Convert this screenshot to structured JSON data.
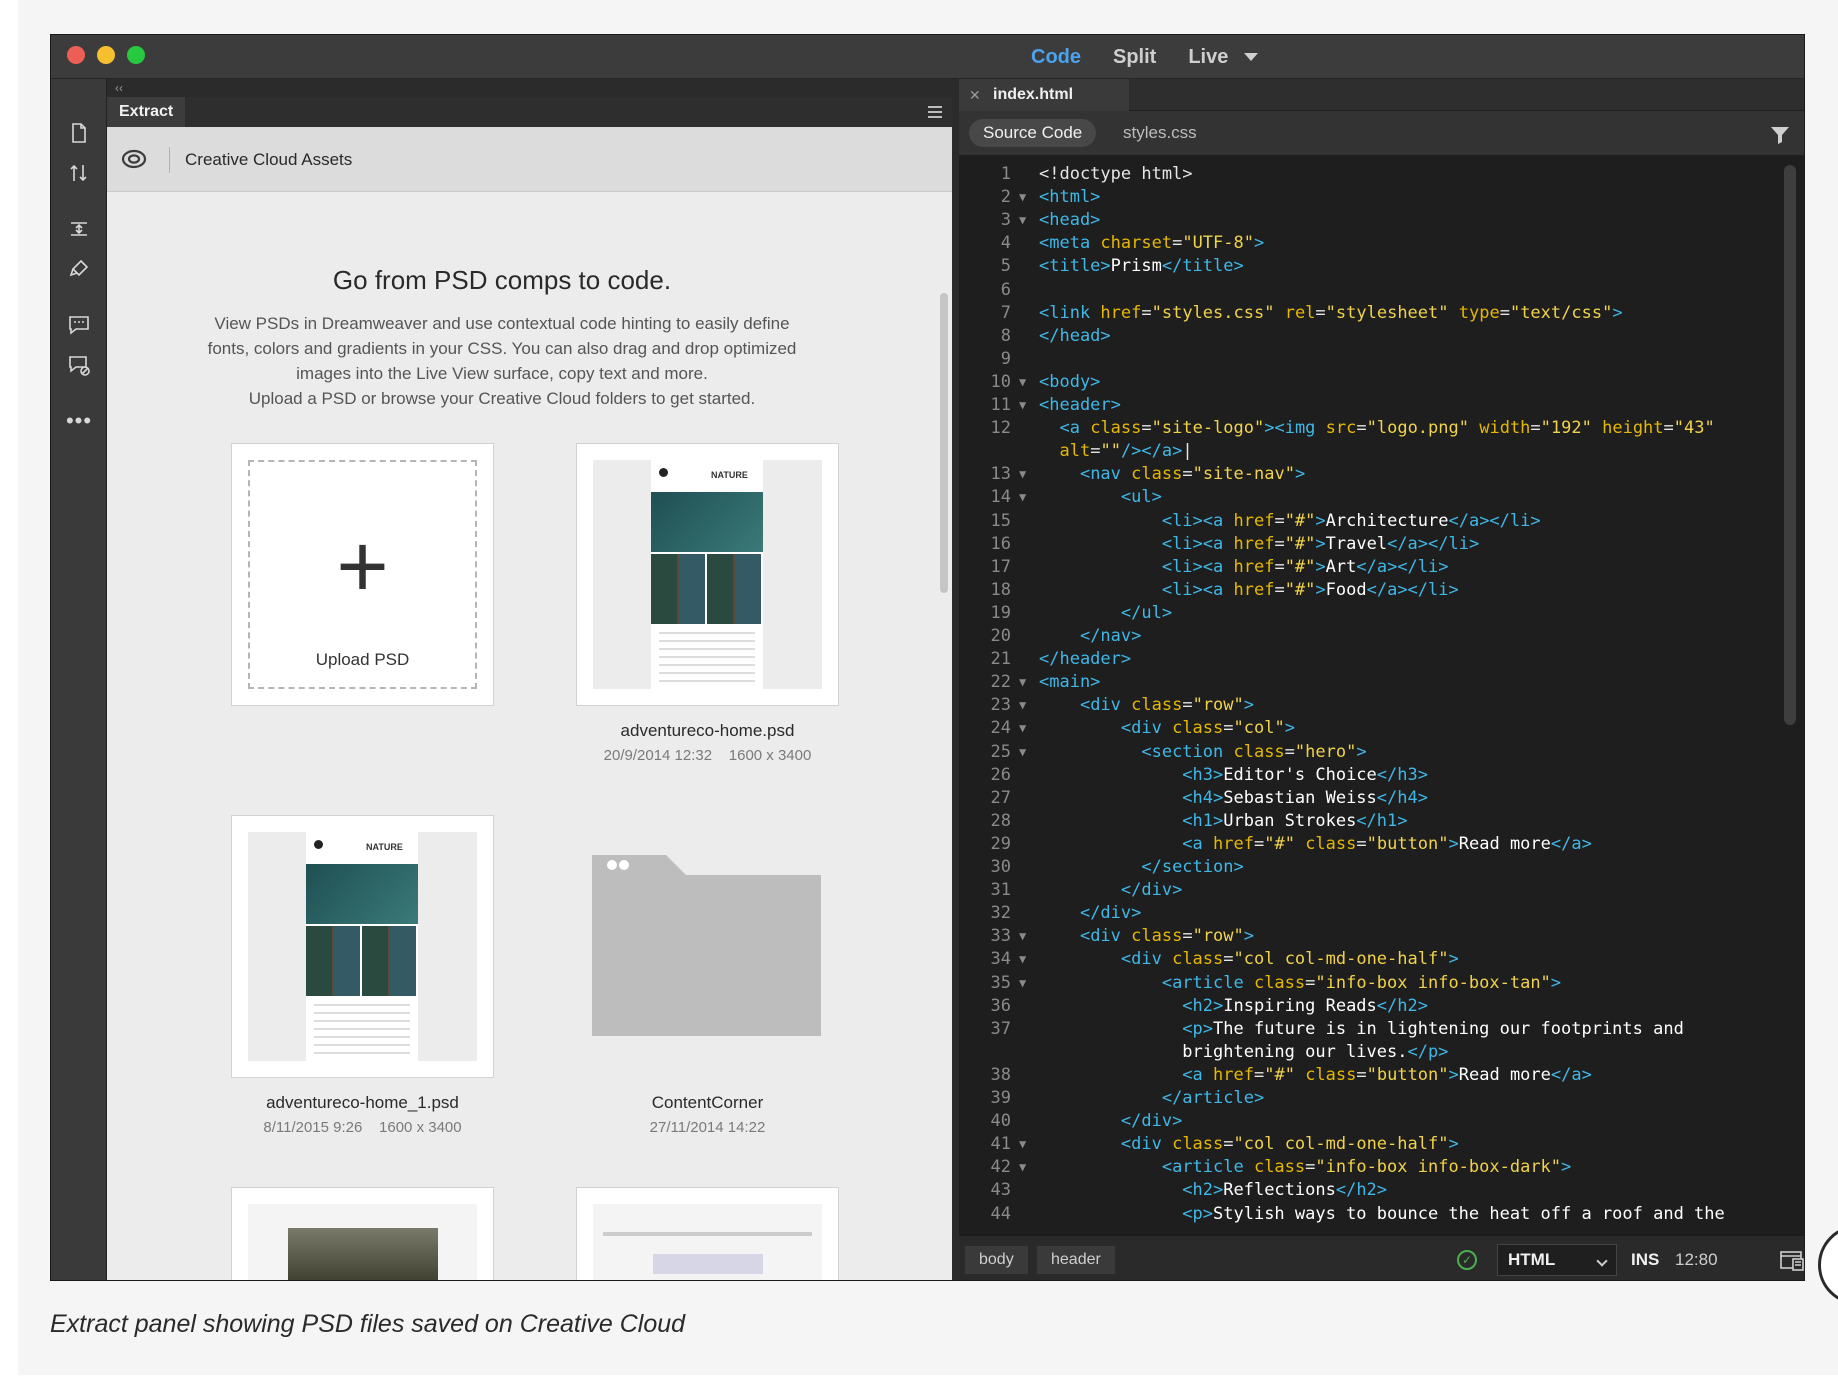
{
  "window": {
    "view_modes": [
      "Code",
      "Split",
      "Live"
    ],
    "active_view": "Code",
    "traffic_colors": [
      "#ed5e56",
      "#f5bf2e",
      "#29c841"
    ]
  },
  "toolbar": {
    "icons": [
      "new-file-icon",
      "get-put-files-icon",
      "expand-collapse-icon",
      "format-source-icon",
      "comment-icon",
      "remove-comment-icon",
      "more-icon"
    ]
  },
  "extract": {
    "panel_tab": "Extract",
    "header_title": "Creative Cloud Assets",
    "hero_title": "Go from PSD comps to code.",
    "hero_lines": [
      "View PSDs in Dreamweaver and use contextual code hinting to easily define",
      "fonts, colors and gradients in your CSS. You can also drag and drop optimized",
      "images into the Live View surface, copy text and more.",
      "Upload a PSD or browse your Creative Cloud folders to get started."
    ],
    "upload_label": "Upload PSD",
    "files": [
      {
        "name": "adventureco-home.psd",
        "date": "20/9/2014 12:32",
        "size": "1600 x 3400"
      },
      {
        "name": "adventureco-home_1.psd",
        "date": "8/11/2015 9:26",
        "size": "1600 x 3400"
      },
      {
        "name": "ContentCorner",
        "date": "27/11/2014 14:22",
        "size": ""
      }
    ],
    "thumb_title": "NATURE"
  },
  "editor": {
    "file_tab": "index.html",
    "related_files": [
      "Source Code",
      "styles.css"
    ],
    "lines": [
      {
        "n": "1",
        "fold": "",
        "html": "&lt;!doctype html&gt;",
        "indent": 0
      },
      {
        "n": "2",
        "fold": "▼",
        "html": "<span class='t'>&lt;html&gt;</span>",
        "indent": 0
      },
      {
        "n": "3",
        "fold": "▼",
        "html": "<span class='t'>&lt;head&gt;</span>",
        "indent": 0
      },
      {
        "n": "4",
        "fold": "",
        "html": "<span class='t'>&lt;meta </span><span class='a'>charset</span>=<span class='s'>\"UTF-8\"</span><span class='t'>&gt;</span>",
        "indent": 0
      },
      {
        "n": "5",
        "fold": "",
        "html": "<span class='t'>&lt;title&gt;</span><span class='x'>Prism</span><span class='t'>&lt;/title&gt;</span>",
        "indent": 0
      },
      {
        "n": "6",
        "fold": "",
        "html": "",
        "indent": 0
      },
      {
        "n": "7",
        "fold": "",
        "html": "<span class='t'>&lt;link </span><span class='a'>href</span>=<span class='s'>\"styles.css\"</span> <span class='a'>rel</span>=<span class='s'>\"stylesheet\"</span> <span class='a'>type</span>=<span class='s'>\"text/css\"</span><span class='t'>&gt;</span>",
        "indent": 0
      },
      {
        "n": "8",
        "fold": "",
        "html": "<span class='t'>&lt;/head&gt;</span>",
        "indent": 0
      },
      {
        "n": "9",
        "fold": "",
        "html": "",
        "indent": 0
      },
      {
        "n": "10",
        "fold": "▼",
        "html": "<span class='t'>&lt;body&gt;</span>",
        "indent": 0
      },
      {
        "n": "11",
        "fold": "▼",
        "html": "<span class='t'>&lt;header&gt;</span>",
        "indent": 0
      },
      {
        "n": "12",
        "fold": "",
        "html": "  <span class='t'>&lt;a </span><span class='a'>class</span>=<span class='s'>\"site-logo\"</span><span class='t'>&gt;&lt;img </span><span class='a'>src</span>=<span class='s'>\"logo.png\"</span> <span class='a'>width</span>=<span class='s'>\"192\"</span> <span class='a'>height</span>=<span class='s'>\"43\"</span>",
        "indent": 0
      },
      {
        "n": "",
        "fold": "",
        "html": "  <span class='a'>alt</span>=<span class='s'>\"\"</span><span class='t'>/&gt;&lt;/a&gt;</span>|",
        "indent": 0
      },
      {
        "n": "13",
        "fold": "▼",
        "html": "    <span class='t'>&lt;nav </span><span class='a'>class</span>=<span class='s'>\"site-nav\"</span><span class='t'>&gt;</span>",
        "indent": 0
      },
      {
        "n": "14",
        "fold": "▼",
        "html": "        <span class='t'>&lt;ul&gt;</span>",
        "indent": 0
      },
      {
        "n": "15",
        "fold": "",
        "html": "            <span class='t'>&lt;li&gt;&lt;a </span><span class='a'>href</span>=<span class='s'>\"#\"</span><span class='t'>&gt;</span><span class='x'>Architecture</span><span class='t'>&lt;/a&gt;&lt;/li&gt;</span>",
        "indent": 0
      },
      {
        "n": "16",
        "fold": "",
        "html": "            <span class='t'>&lt;li&gt;&lt;a </span><span class='a'>href</span>=<span class='s'>\"#\"</span><span class='t'>&gt;</span><span class='x'>Travel</span><span class='t'>&lt;/a&gt;&lt;/li&gt;</span>",
        "indent": 0
      },
      {
        "n": "17",
        "fold": "",
        "html": "            <span class='t'>&lt;li&gt;&lt;a </span><span class='a'>href</span>=<span class='s'>\"#\"</span><span class='t'>&gt;</span><span class='x'>Art</span><span class='t'>&lt;/a&gt;&lt;/li&gt;</span>",
        "indent": 0
      },
      {
        "n": "18",
        "fold": "",
        "html": "            <span class='t'>&lt;li&gt;&lt;a </span><span class='a'>href</span>=<span class='s'>\"#\"</span><span class='t'>&gt;</span><span class='x'>Food</span><span class='t'>&lt;/a&gt;&lt;/li&gt;</span>",
        "indent": 0
      },
      {
        "n": "19",
        "fold": "",
        "html": "        <span class='t'>&lt;/ul&gt;</span>",
        "indent": 0
      },
      {
        "n": "20",
        "fold": "",
        "html": "    <span class='t'>&lt;/nav&gt;</span>",
        "indent": 0
      },
      {
        "n": "21",
        "fold": "",
        "html": "<span class='t'>&lt;/header&gt;</span>",
        "indent": 0
      },
      {
        "n": "22",
        "fold": "▼",
        "html": "<span class='t'>&lt;main&gt;</span>",
        "indent": 0
      },
      {
        "n": "23",
        "fold": "▼",
        "html": "    <span class='t'>&lt;div </span><span class='a'>class</span>=<span class='s'>\"row\"</span><span class='t'>&gt;</span>",
        "indent": 0
      },
      {
        "n": "24",
        "fold": "▼",
        "html": "        <span class='t'>&lt;div </span><span class='a'>class</span>=<span class='s'>\"col\"</span><span class='t'>&gt;</span>",
        "indent": 0
      },
      {
        "n": "25",
        "fold": "▼",
        "html": "          <span class='t'>&lt;section </span><span class='a'>class</span>=<span class='s'>\"hero\"</span><span class='t'>&gt;</span>",
        "indent": 0
      },
      {
        "n": "26",
        "fold": "",
        "html": "              <span class='t'>&lt;h3&gt;</span><span class='x'>Editor's Choice</span><span class='t'>&lt;/h3&gt;</span>",
        "indent": 0
      },
      {
        "n": "27",
        "fold": "",
        "html": "              <span class='t'>&lt;h4&gt;</span><span class='x'>Sebastian Weiss</span><span class='t'>&lt;/h4&gt;</span>",
        "indent": 0
      },
      {
        "n": "28",
        "fold": "",
        "html": "              <span class='t'>&lt;h1&gt;</span><span class='x'>Urban Strokes</span><span class='t'>&lt;/h1&gt;</span>",
        "indent": 0
      },
      {
        "n": "29",
        "fold": "",
        "html": "              <span class='t'>&lt;a </span><span class='a'>href</span>=<span class='s'>\"#\"</span> <span class='a'>class</span>=<span class='s'>\"button\"</span><span class='t'>&gt;</span><span class='x'>Read more</span><span class='t'>&lt;/a&gt;</span>",
        "indent": 0
      },
      {
        "n": "30",
        "fold": "",
        "html": "          <span class='t'>&lt;/section&gt;</span>",
        "indent": 0
      },
      {
        "n": "31",
        "fold": "",
        "html": "        <span class='t'>&lt;/div&gt;</span>",
        "indent": 0
      },
      {
        "n": "32",
        "fold": "",
        "html": "    <span class='t'>&lt;/div&gt;</span>",
        "indent": 0
      },
      {
        "n": "33",
        "fold": "▼",
        "html": "    <span class='t'>&lt;div </span><span class='a'>class</span>=<span class='s'>\"row\"</span><span class='t'>&gt;</span>",
        "indent": 0
      },
      {
        "n": "34",
        "fold": "▼",
        "html": "        <span class='t'>&lt;div </span><span class='a'>class</span>=<span class='s'>\"col col-md-one-half\"</span><span class='t'>&gt;</span>",
        "indent": 0
      },
      {
        "n": "35",
        "fold": "▼",
        "html": "            <span class='t'>&lt;article </span><span class='a'>class</span>=<span class='s'>\"info-box info-box-tan\"</span><span class='t'>&gt;</span>",
        "indent": 0
      },
      {
        "n": "36",
        "fold": "",
        "html": "              <span class='t'>&lt;h2&gt;</span><span class='x'>Inspiring Reads</span><span class='t'>&lt;/h2&gt;</span>",
        "indent": 0
      },
      {
        "n": "37",
        "fold": "",
        "html": "              <span class='t'>&lt;p&gt;</span><span class='x'>The future is in lightening our footprints and</span>",
        "indent": 0
      },
      {
        "n": "",
        "fold": "",
        "html": "              <span class='x'>brightening our lives.</span><span class='t'>&lt;/p&gt;</span>",
        "indent": 0
      },
      {
        "n": "38",
        "fold": "",
        "html": "              <span class='t'>&lt;a </span><span class='a'>href</span>=<span class='s'>\"#\"</span> <span class='a'>class</span>=<span class='s'>\"button\"</span><span class='t'>&gt;</span><span class='x'>Read more</span><span class='t'>&lt;/a&gt;</span>",
        "indent": 0
      },
      {
        "n": "39",
        "fold": "",
        "html": "            <span class='t'>&lt;/article&gt;</span>",
        "indent": 0
      },
      {
        "n": "40",
        "fold": "",
        "html": "        <span class='t'>&lt;/div&gt;</span>",
        "indent": 0
      },
      {
        "n": "41",
        "fold": "▼",
        "html": "        <span class='t'>&lt;div </span><span class='a'>class</span>=<span class='s'>\"col col-md-one-half\"</span><span class='t'>&gt;</span>",
        "indent": 0
      },
      {
        "n": "42",
        "fold": "▼",
        "html": "            <span class='t'>&lt;article </span><span class='a'>class</span>=<span class='s'>\"info-box info-box-dark\"</span><span class='t'>&gt;</span>",
        "indent": 0
      },
      {
        "n": "43",
        "fold": "",
        "html": "              <span class='t'>&lt;h2&gt;</span><span class='x'>Reflections</span><span class='t'>&lt;/h2&gt;</span>",
        "indent": 0
      },
      {
        "n": "44",
        "fold": "",
        "html": "              <span class='t'>&lt;p&gt;</span><span class='x'>Stylish ways to bounce the heat off a roof and the</span>",
        "indent": 0
      }
    ]
  },
  "status": {
    "crumbs": [
      "body",
      "header"
    ],
    "language": "HTML",
    "mode": "INS",
    "cursor": "12:80"
  },
  "caption": "Extract panel showing PSD files saved on Creative Cloud"
}
